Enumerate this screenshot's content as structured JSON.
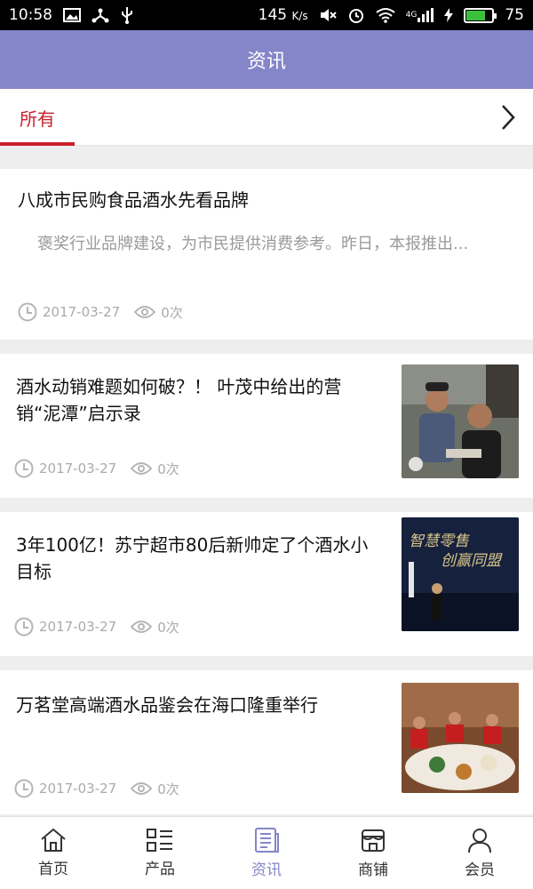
{
  "status_bar": {
    "time": "10:58",
    "speed": "145",
    "speed_unit": "K/s",
    "network": "4G",
    "battery": "75",
    "battery_fraction": 0.75
  },
  "header": {
    "title": "资讯"
  },
  "tabs": {
    "active_label": "所有"
  },
  "news": [
    {
      "title": "八成市民购食品酒水先看品牌",
      "summary": "褒奖行业品牌建设，为市民提供消费参考。昨日，本报推出...",
      "date": "2017-03-27",
      "views": "0次"
    },
    {
      "title": "酒水动销难题如何破？！ 叶茂中给出的营销“泥潭”启示录",
      "date": "2017-03-27",
      "views": "0次"
    },
    {
      "title": "3年100亿！苏宁超市80后新帅定了个酒水小目标",
      "date": "2017-03-27",
      "views": "0次",
      "thumb_text_1": "智慧零售",
      "thumb_text_2": "创赢同盟"
    },
    {
      "title": "万茗堂高端酒水品鉴会在海口隆重举行",
      "date": "2017-03-27",
      "views": "0次"
    }
  ],
  "bottom_nav": [
    {
      "label": "首页",
      "icon": "home-icon"
    },
    {
      "label": "产品",
      "icon": "grid-list-icon"
    },
    {
      "label": "资讯",
      "icon": "news-icon"
    },
    {
      "label": "商铺",
      "icon": "shop-icon"
    },
    {
      "label": "会员",
      "icon": "user-icon"
    }
  ],
  "colors": {
    "header_bg": "#8585c9",
    "accent_red": "#c8202a",
    "active_nav": "#8585c9"
  }
}
